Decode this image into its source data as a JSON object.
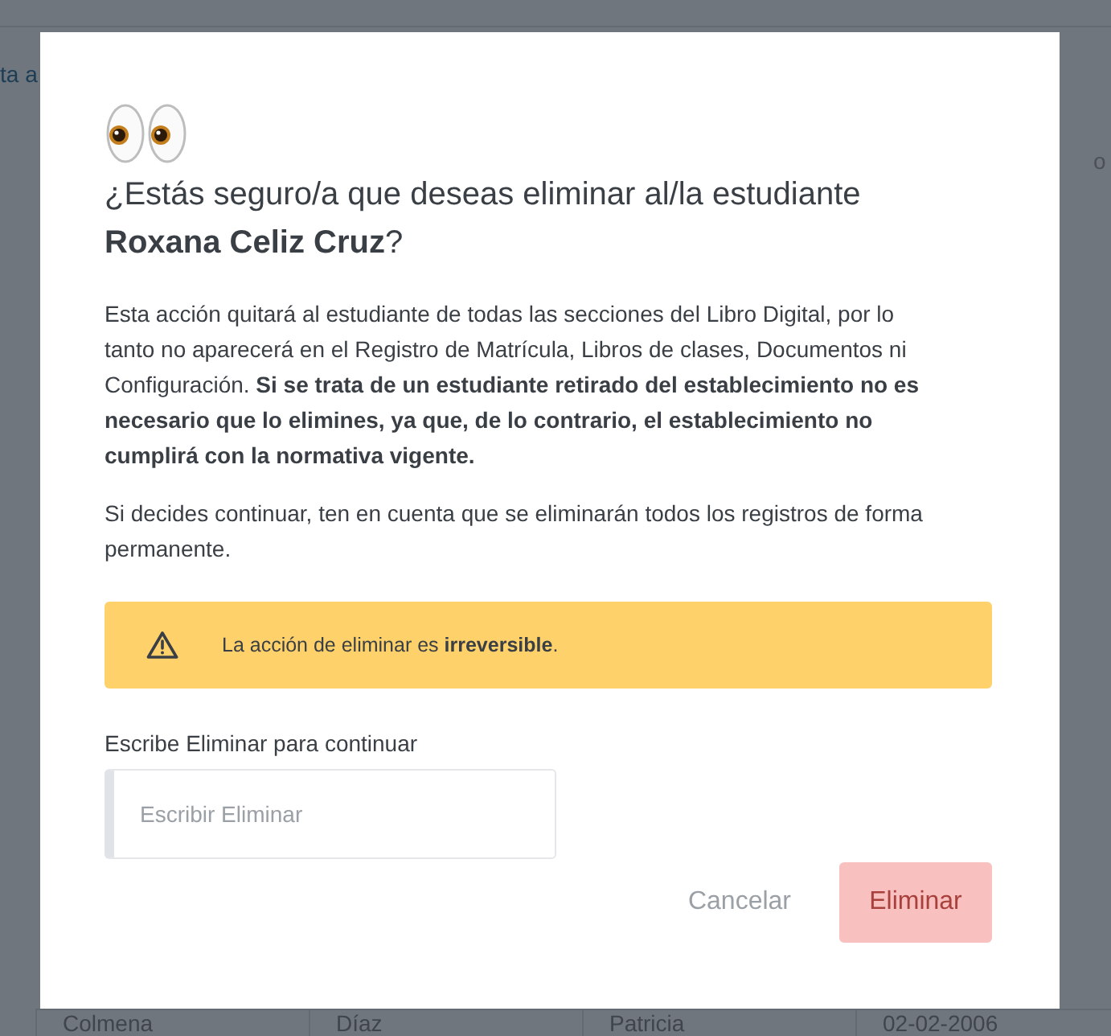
{
  "background": {
    "link_fragment": "ta a",
    "header_fragment": "o",
    "last_row": [
      "Colmena",
      "Díaz",
      "Patricia",
      "02-02-2006"
    ]
  },
  "dialog": {
    "title": "¿Estás seguro/a que deseas eliminar al/la estudiante **Roxana Celiz Cruz**?",
    "paragraphs": [
      "Esta acción quitará al estudiante de todas las secciones del Libro Digital, por lo tanto no aparecerá en el Registro de Matrícula, Libros de clases, Documentos ni Configuración. **Si se trata de un estudiante retirado del establecimiento no es necesario que lo elimines, ya que, de lo contrario, el establecimiento no cumplirá con la normativa vigente.**",
      "Si decides continuar, ten en cuenta que se eliminarán todos los registros de forma permanente."
    ],
    "alert": "La acción de eliminar es **irreversible**.",
    "field_label": "Escribe Eliminar para continuar",
    "field": {
      "placeholder": "Escribir Eliminar"
    },
    "buttons": [
      {
        "label": "Cancelar",
        "kind": "cancel",
        "disabled": false
      },
      {
        "label": "Eliminar",
        "kind": "danger",
        "disabled": true
      }
    ]
  }
}
